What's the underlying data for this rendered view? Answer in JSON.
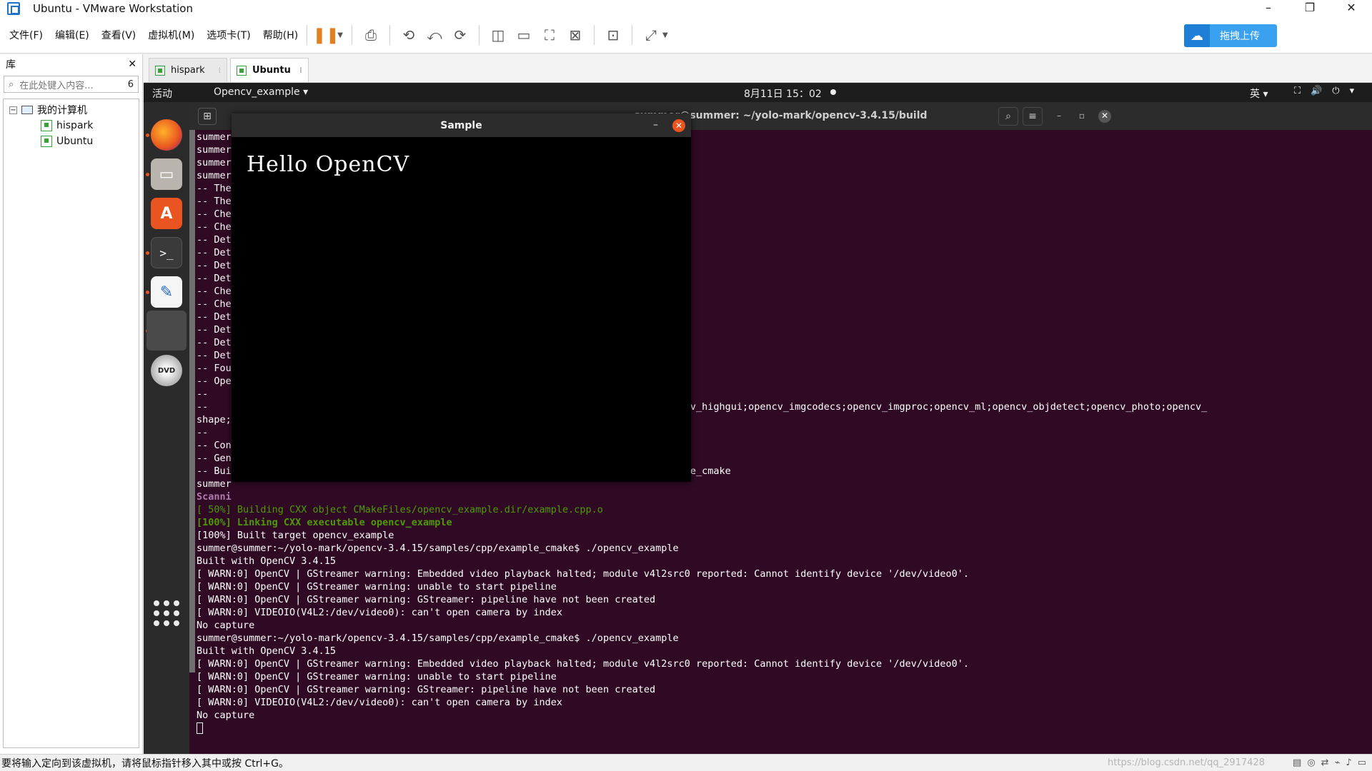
{
  "window": {
    "title": "Ubuntu - VMware Workstation",
    "minimize": "–",
    "restore": "❐",
    "close": "✕"
  },
  "menu": [
    "文件(F)",
    "编辑(E)",
    "查看(V)",
    "虚拟机(M)",
    "选项卡(T)",
    "帮助(H)"
  ],
  "toolbar": {
    "upload_label": "拖拽上传",
    "accent": "#3aa0f0"
  },
  "library": {
    "title": "库",
    "close": "✕",
    "search_placeholder": "在此处键入内容...",
    "search_count": "6",
    "tree": {
      "root": "我的计算机",
      "expander": "−",
      "children": [
        "hispark",
        "Ubuntu"
      ]
    }
  },
  "vm_tabs": [
    {
      "label": "hispark",
      "active": false
    },
    {
      "label": "Ubuntu",
      "active": true
    }
  ],
  "ubuntu": {
    "activities": "活动",
    "app_menu": "Opencv_example ▾",
    "clock": "8月11日  15：02",
    "ime": "英 ▾",
    "tray": [
      "⛶",
      "🔊",
      "⏻",
      "▾"
    ]
  },
  "terminal": {
    "title": "summer@summer: ~/yolo-mark/opencv-3.4.15/build",
    "new_tab": "⊞",
    "search": "⌕",
    "menu": "≡",
    "min": "–",
    "max": "▫",
    "close": "✕",
    "lines": [
      {
        "text": "summer",
        "cls": ""
      },
      {
        "text": "summer",
        "cls": ""
      },
      {
        "text": "summer",
        "cls": ""
      },
      {
        "text": "summer",
        "cls": ""
      },
      {
        "text": "-- The",
        "cls": ""
      },
      {
        "text": "-- The",
        "cls": ""
      },
      {
        "text": "-- Che",
        "cls": ""
      },
      {
        "text": "-- Che",
        "cls": ""
      },
      {
        "text": "-- Det",
        "cls": ""
      },
      {
        "text": "-- Det",
        "cls": ""
      },
      {
        "text": "-- Det",
        "cls": ""
      },
      {
        "text": "-- Det",
        "cls": ""
      },
      {
        "text": "-- Che",
        "cls": ""
      },
      {
        "text": "-- Che",
        "cls": ""
      },
      {
        "text": "-- Det",
        "cls": ""
      },
      {
        "text": "-- Det",
        "cls": ""
      },
      {
        "text": "-- Det",
        "cls": ""
      },
      {
        "text": "-- Det",
        "cls": ""
      },
      {
        "text": "-- Fou",
        "cls": ""
      },
      {
        "text": "-- Ope",
        "cls": ""
      },
      {
        "text": "--",
        "cls": ""
      },
      {
        "text": "--                                                                   encv_flann;opencv_highgui;opencv_imgcodecs;opencv_imgproc;opencv_ml;opencv_objdetect;opencv_photo;opencv_",
        "cls": ""
      },
      {
        "text": "shape;                                                               ideostab",
        "cls": ""
      },
      {
        "text": "--",
        "cls": ""
      },
      {
        "text": "-- Con",
        "cls": ""
      },
      {
        "text": "-- Gen",
        "cls": ""
      },
      {
        "text": "-- Bui                                                               mples/cpp/example_cmake",
        "cls": ""
      },
      {
        "text": "summer",
        "cls": ""
      },
      {
        "text": "Scanni",
        "cls": "purple"
      },
      {
        "text": "[ 50%] Building CXX object CMakeFiles/opencv_example.dir/example.cpp.o",
        "cls": "green"
      },
      {
        "text": "[100%] Linking CXX executable opencv_example",
        "cls": "bgreen"
      },
      {
        "text": "[100%] Built target opencv_example",
        "cls": ""
      },
      {
        "text": "summer@summer:~/yolo-mark/opencv-3.4.15/samples/cpp/example_cmake$ ./opencv_example",
        "cls": ""
      },
      {
        "text": "Built with OpenCV 3.4.15",
        "cls": ""
      },
      {
        "text": "[ WARN:0] OpenCV | GStreamer warning: Embedded video playback halted; module v4l2src0 reported: Cannot identify device '/dev/video0'.",
        "cls": ""
      },
      {
        "text": "[ WARN:0] OpenCV | GStreamer warning: unable to start pipeline",
        "cls": ""
      },
      {
        "text": "[ WARN:0] OpenCV | GStreamer warning: GStreamer: pipeline have not been created",
        "cls": ""
      },
      {
        "text": "[ WARN:0] VIDEOIO(V4L2:/dev/video0): can't open camera by index",
        "cls": ""
      },
      {
        "text": "No capture",
        "cls": ""
      },
      {
        "text": "summer@summer:~/yolo-mark/opencv-3.4.15/samples/cpp/example_cmake$ ./opencv_example",
        "cls": ""
      },
      {
        "text": "Built with OpenCV 3.4.15",
        "cls": ""
      },
      {
        "text": "[ WARN:0] OpenCV | GStreamer warning: Embedded video playback halted; module v4l2src0 reported: Cannot identify device '/dev/video0'.",
        "cls": ""
      },
      {
        "text": "[ WARN:0] OpenCV | GStreamer warning: unable to start pipeline",
        "cls": ""
      },
      {
        "text": "[ WARN:0] OpenCV | GStreamer warning: GStreamer: pipeline have not been created",
        "cls": ""
      },
      {
        "text": "[ WARN:0] VIDEOIO(V4L2:/dev/video0): can't open camera by index",
        "cls": ""
      },
      {
        "text": "No capture",
        "cls": ""
      }
    ]
  },
  "sample_window": {
    "title": "Sample",
    "text": "Hello OpenCV",
    "min": "–",
    "close": "✕"
  },
  "dock": {
    "software_glyph": "A",
    "terminal_glyph": ">_",
    "editor_glyph": "✎",
    "dvd_label": "DVD"
  },
  "statusbar": {
    "message": "要将输入定向到该虚拟机，请将鼠标指针移入其中或按 Ctrl+G。",
    "watermark": "https://blog.csdn.net/qq_2917428"
  }
}
